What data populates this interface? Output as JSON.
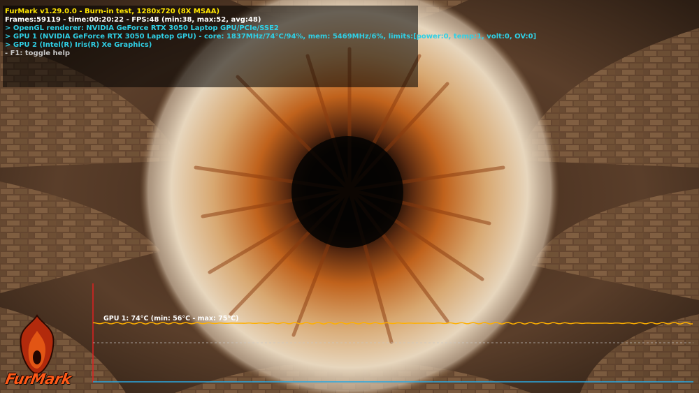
{
  "hud": {
    "title": "FurMark v1.29.0.0 - Burn-in test, 1280x720 (8X MSAA)",
    "frames": "Frames:59119 - time:00:20:22 - FPS:48 (min:38, max:52, avg:48)",
    "renderer": "> OpenGL renderer: NVIDIA GeForce RTX 3050 Laptop GPU/PCIe/SSE2",
    "gpu1": "> GPU 1 (NVIDIA GeForce RTX 3050 Laptop GPU) - core: 1837MHz/74°C/94%, mem: 5469MHz/6%, limits:[power:0, temp:1, volt:0, OV:0]",
    "gpu2": "> GPU 2 (Intel(R) Iris(R) Xe Graphics)",
    "help": "- F1: toggle help"
  },
  "graph": {
    "label": "GPU 1: 74°C (min: 56°C - max: 75°C)",
    "current_temp_c": 74,
    "colors": {
      "temp_line": "#ffb000",
      "axis_y": "#e02020",
      "axis_x": "#2aa7e0",
      "dashed": "#c8c8c8"
    }
  },
  "logo": {
    "text": "FurMark",
    "icon": "flame-icon"
  }
}
